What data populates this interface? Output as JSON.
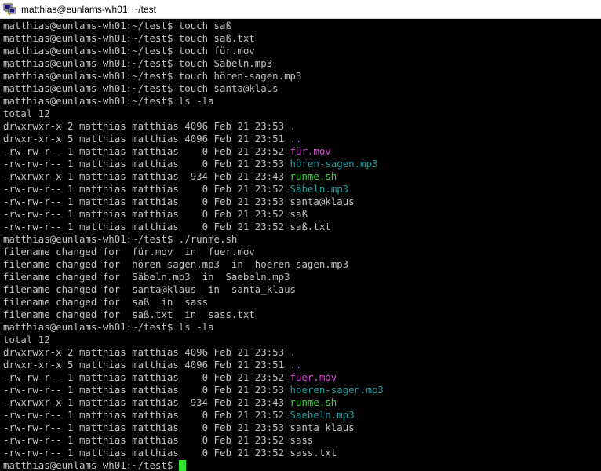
{
  "window": {
    "title": "matthias@eunlams-wh01: ~/test",
    "icon": "putty-icon"
  },
  "colors": {
    "background": "#000000",
    "text": "#c0c0c0",
    "directory": "#7777ff",
    "media": "#d24ad2",
    "audio": "#1fa0a0",
    "executable": "#3fd13f",
    "cursor": "#2ee52e"
  },
  "terminal": {
    "lines": [
      "matthias@eunlams-wh01:~/test$ touch saß",
      "matthias@eunlams-wh01:~/test$ touch saß.txt",
      "matthias@eunlams-wh01:~/test$ touch für.mov",
      "matthias@eunlams-wh01:~/test$ touch Säbeln.mp3",
      "matthias@eunlams-wh01:~/test$ touch hören-sagen.mp3",
      "matthias@eunlams-wh01:~/test$ touch santa@klaus",
      "matthias@eunlams-wh01:~/test$ ls -la",
      "total 12"
    ],
    "listing1": [
      {
        "prefix": "drwxrwxr-x 2 matthias matthias 4096 Feb 21 23:53 ",
        "name": ".",
        "color": "blue"
      },
      {
        "prefix": "drwxr-xr-x 5 matthias matthias 4096 Feb 21 23:51 ",
        "name": "..",
        "color": "blue"
      },
      {
        "prefix": "-rw-rw-r-- 1 matthias matthias    0 Feb 21 23:52 ",
        "name": "für.mov",
        "color": "magenta"
      },
      {
        "prefix": "-rw-rw-r-- 1 matthias matthias    0 Feb 21 23:53 ",
        "name": "hören-sagen.mp3",
        "color": "cyan"
      },
      {
        "prefix": "-rwxrwxr-x 1 matthias matthias  934 Feb 21 23:43 ",
        "name": "runme.sh",
        "color": "green"
      },
      {
        "prefix": "-rw-rw-r-- 1 matthias matthias    0 Feb 21 23:52 ",
        "name": "Säbeln.mp3",
        "color": "cyan"
      },
      {
        "prefix": "-rw-rw-r-- 1 matthias matthias    0 Feb 21 23:53 ",
        "name": "santa@klaus",
        "color": "plain"
      },
      {
        "prefix": "-rw-rw-r-- 1 matthias matthias    0 Feb 21 23:52 ",
        "name": "saß",
        "color": "plain"
      },
      {
        "prefix": "-rw-rw-r-- 1 matthias matthias    0 Feb 21 23:52 ",
        "name": "saß.txt",
        "color": "plain"
      }
    ],
    "middle_lines": [
      "matthias@eunlams-wh01:~/test$ ./runme.sh",
      "filename changed for  für.mov  in  fuer.mov",
      "filename changed for  hören-sagen.mp3  in  hoeren-sagen.mp3",
      "filename changed for  Säbeln.mp3  in  Saebeln.mp3",
      "filename changed for  santa@klaus  in  santa_klaus",
      "filename changed for  saß  in  sass",
      "filename changed for  saß.txt  in  sass.txt",
      "matthias@eunlams-wh01:~/test$ ls -la",
      "total 12"
    ],
    "listing2": [
      {
        "prefix": "drwxrwxr-x 2 matthias matthias 4096 Feb 21 23:53 ",
        "name": ".",
        "color": "blue"
      },
      {
        "prefix": "drwxr-xr-x 5 matthias matthias 4096 Feb 21 23:51 ",
        "name": "..",
        "color": "blue"
      },
      {
        "prefix": "-rw-rw-r-- 1 matthias matthias    0 Feb 21 23:52 ",
        "name": "fuer.mov",
        "color": "magenta"
      },
      {
        "prefix": "-rw-rw-r-- 1 matthias matthias    0 Feb 21 23:53 ",
        "name": "hoeren-sagen.mp3",
        "color": "cyan"
      },
      {
        "prefix": "-rwxrwxr-x 1 matthias matthias  934 Feb 21 23:43 ",
        "name": "runme.sh",
        "color": "green"
      },
      {
        "prefix": "-rw-rw-r-- 1 matthias matthias    0 Feb 21 23:52 ",
        "name": "Saebeln.mp3",
        "color": "cyan"
      },
      {
        "prefix": "-rw-rw-r-- 1 matthias matthias    0 Feb 21 23:53 ",
        "name": "santa_klaus",
        "color": "plain"
      },
      {
        "prefix": "-rw-rw-r-- 1 matthias matthias    0 Feb 21 23:52 ",
        "name": "sass",
        "color": "plain"
      },
      {
        "prefix": "-rw-rw-r-- 1 matthias matthias    0 Feb 21 23:52 ",
        "name": "sass.txt",
        "color": "plain"
      }
    ],
    "prompt": "matthias@eunlams-wh01:~/test$ "
  }
}
